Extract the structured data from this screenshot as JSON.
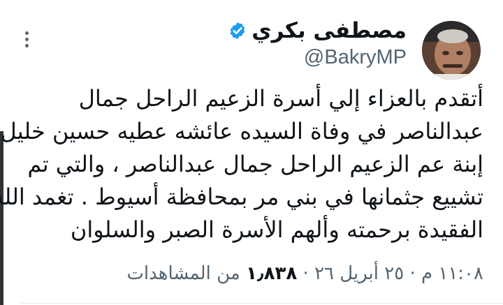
{
  "author": {
    "display_name": "مصطفى بكري",
    "handle": "@BakryMP",
    "verified": true,
    "avatar_icon": "profile-photo"
  },
  "tweet": {
    "lines": [
      "أتقدم بالعزاء إلي أسرة الزعيم الراحل جمال",
      "عبدالناصر في وفاة السيده عائشه عطيه حسين خليل",
      "إبنة عم الزعيم الراحل جمال عبدالناصر ، والتي تم",
      "تشييع جثمانها في بني مر بمحافظة أسيوط . تغمد الله",
      "الفقيدة برحمته وألهم الأسرة الصبر والسلوان"
    ]
  },
  "meta": {
    "time": "١١:٠٨ م",
    "separator1": "·",
    "date": "٢٥ أبريل ٢٦",
    "separator2": "·",
    "views_count": "١٫٨٣٨",
    "views_label": "من المشاهدات"
  },
  "colors": {
    "text": "#0f1419",
    "secondary": "#536471",
    "verified": "#1d9bf0"
  }
}
